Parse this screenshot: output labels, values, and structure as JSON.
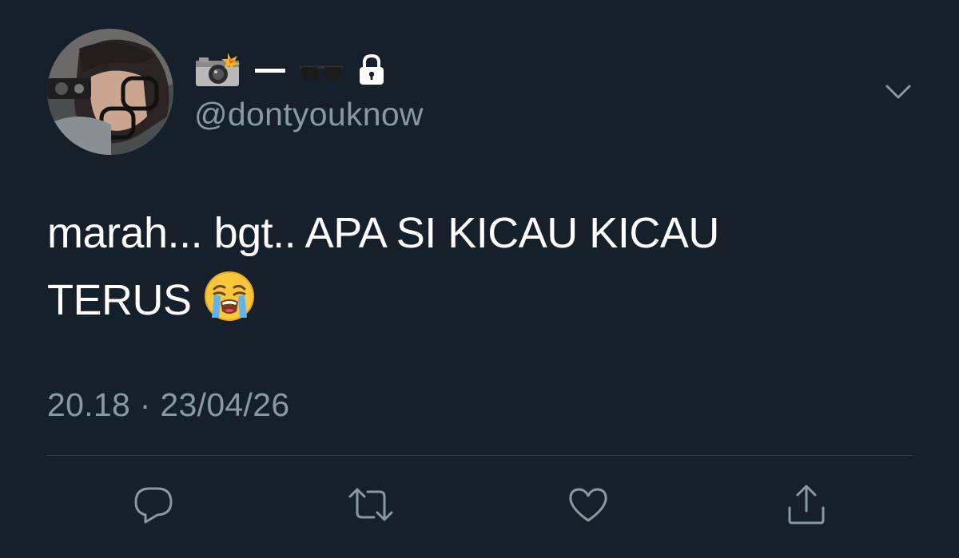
{
  "tweet": {
    "author": {
      "display_name_icons": [
        "camera-flash-icon",
        "dash-icon",
        "sunglasses-icon"
      ],
      "protected_icon": "lock-icon",
      "handle": "@dontyouknow"
    },
    "text_line_1": "marah... bgt.. APA SI KICAU KICAU",
    "text_line_2": "TERUS",
    "text_emoji": "loudly-crying-face-icon",
    "timestamp": "20.18 · 23/04/26",
    "menu_icon": "chevron-down-icon",
    "actions": [
      {
        "icon": "reply-icon"
      },
      {
        "icon": "retweet-icon"
      },
      {
        "icon": "like-icon"
      },
      {
        "icon": "share-icon"
      }
    ]
  },
  "colors": {
    "background": "#15202b",
    "primary_text": "#ffffff",
    "secondary_text": "#8899a6",
    "divider": "#38444d"
  }
}
